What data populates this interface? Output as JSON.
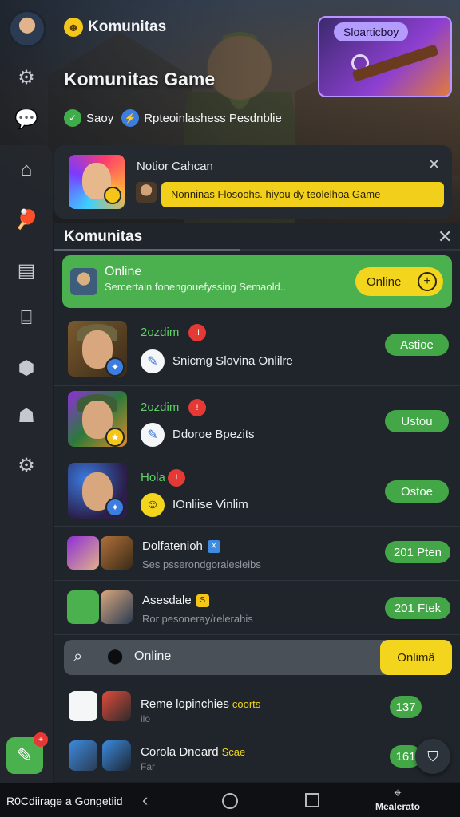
{
  "header": {
    "app_title": "Komunitas",
    "hero_title": "Komunitas Game",
    "tags": [
      {
        "label": "Saoy",
        "icon": "check-icon",
        "color": "#3fae4a"
      },
      {
        "label": "Rpteoinlashess Pesdnblie",
        "icon": "bolt-icon",
        "color": "#3c7de0"
      }
    ],
    "promo_label": "Sloarticboy"
  },
  "notification": {
    "title": "Notior Cahcan",
    "message": "Nonninas Flosoohs. hiyou dy teolelhoa Game"
  },
  "panel": {
    "title": "Komunitas",
    "online_banner": {
      "title": "Online",
      "subtitle": "Sercertain fonengouefyssing Semaold..",
      "button_label": "Online"
    },
    "posts": [
      {
        "name": "2ozdim",
        "badge_count": "!!",
        "text": "Snicmg Slovina Onlilre",
        "button": "Astioe",
        "badge_color": "#3c7de0"
      },
      {
        "name": "2ozdim",
        "badge_count": "!",
        "text": "Ddoroe Bpezits",
        "button": "Ustou",
        "badge_color": "#f5c518"
      },
      {
        "name": "Hola",
        "badge_count": "!",
        "text": "IOnliise Vinlim",
        "button": "Ostoe",
        "badge_color": "#3c7de0"
      }
    ],
    "groups": [
      {
        "name": "Dolfatenioh",
        "badge": "X",
        "sub": "Ses psserondgoralesleibs",
        "button": "201 Pten",
        "badge_color": "#3c8be0"
      },
      {
        "name": "Asesdale",
        "badge": "S",
        "sub": "Ror pesoneray/relerahis",
        "button": "201 Ftek",
        "badge_color": "#f5c518"
      }
    ],
    "search": {
      "label": "Online",
      "button_label": "Onlimä"
    },
    "friends": [
      {
        "name": "Reme lopinchies",
        "extra": "coorts",
        "extra_color": "#f2d51c",
        "sub": "ilo",
        "count": "137"
      },
      {
        "name": "Corola Dneard",
        "extra": "Scae",
        "extra_color": "#f2d51c",
        "sub": "Far",
        "count": "161"
      }
    ]
  },
  "navbar": {
    "left_label": "R0Cdiirage a Gongetiid",
    "right_label": "Mealerato"
  }
}
